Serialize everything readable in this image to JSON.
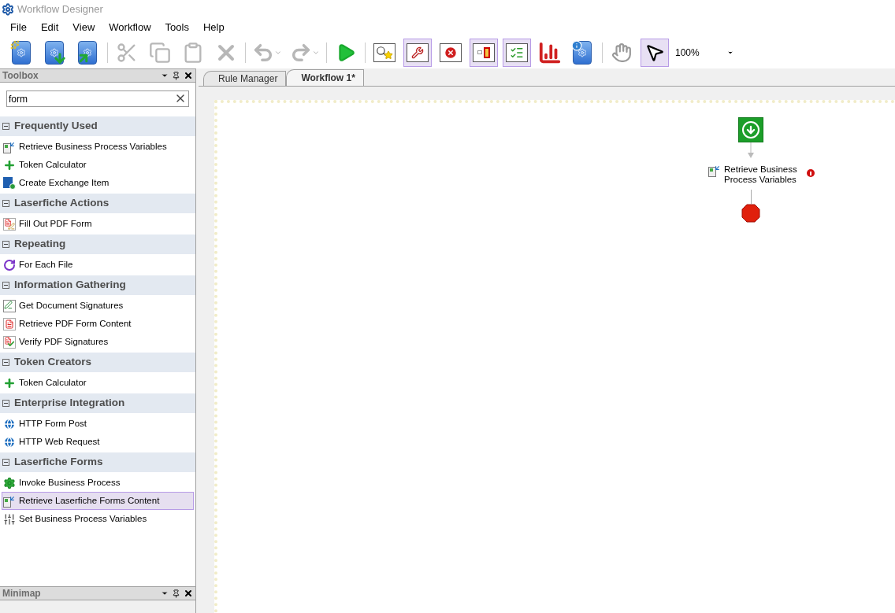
{
  "window": {
    "title": "Workflow Designer"
  },
  "menu": [
    "File",
    "Edit",
    "View",
    "Workflow",
    "Tools",
    "Help"
  ],
  "toolbar": [
    {
      "kind": "new",
      "disabled": false,
      "selected": false
    },
    {
      "kind": "import",
      "disabled": false,
      "selected": false
    },
    {
      "kind": "export",
      "disabled": false,
      "selected": false
    },
    {
      "kind": "separator"
    },
    {
      "kind": "cut",
      "disabled": true,
      "selected": false
    },
    {
      "kind": "copy",
      "disabled": true,
      "selected": false
    },
    {
      "kind": "paste",
      "disabled": true,
      "selected": false
    },
    {
      "kind": "delete",
      "disabled": true,
      "selected": false
    },
    {
      "kind": "separator"
    },
    {
      "kind": "undo",
      "disabled": true,
      "selected": false
    },
    {
      "kind": "redo",
      "disabled": true,
      "selected": false
    },
    {
      "kind": "separator"
    },
    {
      "kind": "run",
      "disabled": false,
      "selected": false
    },
    {
      "kind": "separator"
    },
    {
      "kind": "find",
      "disabled": false,
      "selected": false
    },
    {
      "kind": "properties",
      "disabled": false,
      "selected": true
    },
    {
      "kind": "errors",
      "disabled": false,
      "selected": false
    },
    {
      "kind": "layout",
      "disabled": false,
      "selected": true
    },
    {
      "kind": "checklist",
      "disabled": false,
      "selected": true
    },
    {
      "kind": "chart",
      "disabled": false,
      "selected": false
    },
    {
      "kind": "info",
      "disabled": false,
      "selected": false
    },
    {
      "kind": "separator"
    },
    {
      "kind": "hand",
      "disabled": false,
      "selected": false
    },
    {
      "kind": "pointer",
      "disabled": false,
      "selected": true
    }
  ],
  "zoom": {
    "value": "100%"
  },
  "toolbox": {
    "title": "Toolbox",
    "search": {
      "value": "form"
    },
    "groups": [
      {
        "title": "Frequently Used",
        "expanded": true,
        "items": [
          {
            "label": "Retrieve Business Process Variables",
            "kind": "retrieve",
            "selected": false
          },
          {
            "label": "Token Calculator",
            "kind": "plus",
            "selected": false
          },
          {
            "label": "Create Exchange Item",
            "kind": "exchange",
            "selected": false
          }
        ]
      },
      {
        "title": "Laserfiche Actions",
        "expanded": true,
        "items": [
          {
            "label": "Fill Out PDF Form",
            "kind": "pdf-edit",
            "selected": false
          }
        ]
      },
      {
        "title": "Repeating",
        "expanded": true,
        "items": [
          {
            "label": "For Each File",
            "kind": "loop",
            "selected": false
          }
        ]
      },
      {
        "title": "Information Gathering",
        "expanded": true,
        "items": [
          {
            "label": "Get Document Signatures",
            "kind": "signature",
            "selected": false
          },
          {
            "label": "Retrieve PDF Form Content",
            "kind": "pdf",
            "selected": false
          },
          {
            "label": "Verify PDF Signatures",
            "kind": "pdf-check",
            "selected": false
          }
        ]
      },
      {
        "title": "Token Creators",
        "expanded": true,
        "items": [
          {
            "label": "Token Calculator",
            "kind": "plus",
            "selected": false
          }
        ]
      },
      {
        "title": "Enterprise Integration",
        "expanded": true,
        "items": [
          {
            "label": "HTTP Form Post",
            "kind": "globe",
            "selected": false
          },
          {
            "label": "HTTP Web Request",
            "kind": "globe",
            "selected": false
          }
        ]
      },
      {
        "title": "Laserfiche Forms",
        "expanded": true,
        "items": [
          {
            "label": "Invoke Business Process",
            "kind": "gear",
            "selected": false
          },
          {
            "label": "Retrieve Laserfiche Forms Content",
            "kind": "retrieve",
            "selected": true
          },
          {
            "label": "Set Business Process Variables",
            "kind": "sliders",
            "selected": false
          }
        ]
      }
    ]
  },
  "minimap": {
    "title": "Minimap"
  },
  "tabs": [
    {
      "label": "Rule Manager",
      "selected": false
    },
    {
      "label": "Workflow 1*",
      "selected": true
    }
  ],
  "canvas": {
    "activity": {
      "label_lines": [
        "Retrieve Business",
        "Process Variables"
      ],
      "error": true
    }
  }
}
